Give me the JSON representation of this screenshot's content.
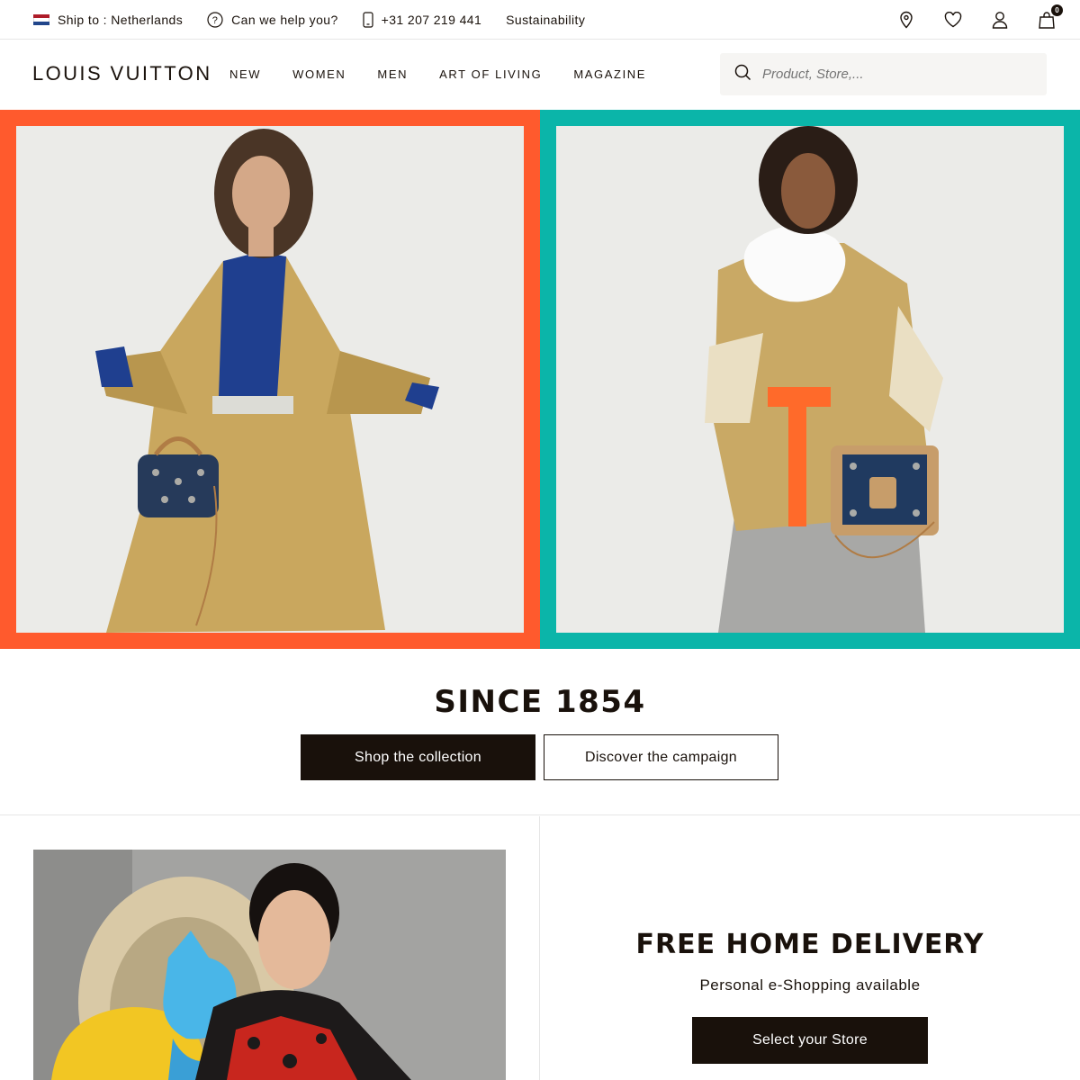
{
  "util_bar": {
    "ship_to": "Ship to : Netherlands",
    "help": "Can we help you?",
    "phone": "+31 207 219 441",
    "sustainability": "Sustainability",
    "cart_count": "0"
  },
  "header": {
    "logo": "LOUIS VUITTON",
    "nav": [
      "NEW",
      "WOMEN",
      "MEN",
      "ART OF LIVING",
      "MAGAZINE"
    ],
    "search_placeholder": "Product, Store,..."
  },
  "hero": {
    "left_color": "#ff5a2d",
    "right_color": "#0bb5a9"
  },
  "since": {
    "title": "SINCE 1854",
    "shop_button": "Shop the collection",
    "campaign_button": "Discover the campaign"
  },
  "delivery": {
    "title": "FREE HOME DELIVERY",
    "subtitle": "Personal e-Shopping available",
    "store_button": "Select your Store"
  },
  "icons": [
    "nl-flag-icon",
    "help-icon",
    "phone-icon",
    "location-pin-icon",
    "heart-icon",
    "user-icon",
    "shopping-bag-icon",
    "search-icon"
  ]
}
